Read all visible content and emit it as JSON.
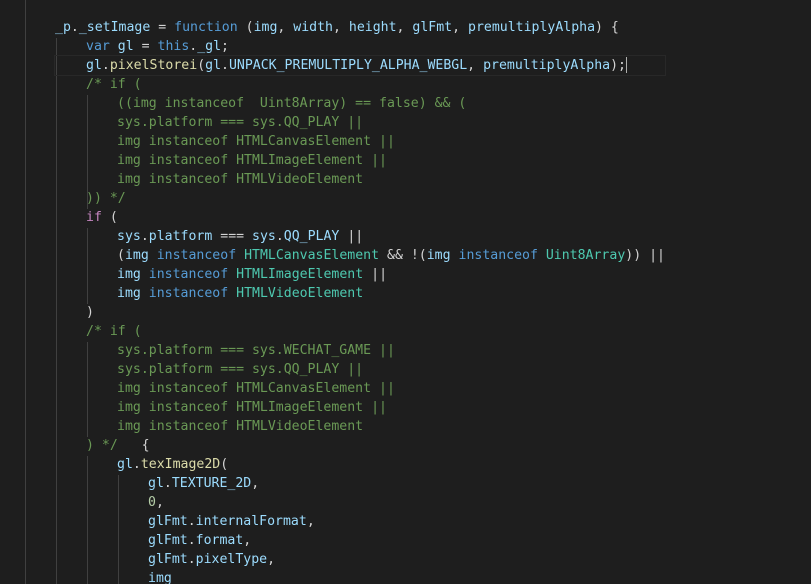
{
  "editor": {
    "theme": {
      "background": "#1e1e1e",
      "default": "#d4d4d4",
      "keyword": "#569cd6",
      "control": "#c586c0",
      "function": "#dcdcaa",
      "variable": "#9cdcfe",
      "type": "#4ec9b0",
      "number": "#b5cea8",
      "comment": "#6a9955",
      "guide": "#404040"
    },
    "cursor_line": 3,
    "lines": [
      {
        "indent": 0,
        "tokens": [
          [
            "_p",
            "variable"
          ],
          [
            ".",
            ""
          ],
          [
            "_setImage",
            "variable"
          ],
          [
            " = ",
            ""
          ],
          [
            "function",
            "keyword"
          ],
          [
            " (",
            ""
          ],
          [
            "img",
            "variable"
          ],
          [
            ", ",
            ""
          ],
          [
            "width",
            "variable"
          ],
          [
            ", ",
            ""
          ],
          [
            "height",
            "variable"
          ],
          [
            ", ",
            ""
          ],
          [
            "glFmt",
            "variable"
          ],
          [
            ", ",
            ""
          ],
          [
            "premultiplyAlpha",
            "variable"
          ],
          [
            ") {",
            ""
          ]
        ]
      },
      {
        "indent": 1,
        "tokens": [
          [
            "var",
            "keyword"
          ],
          [
            " ",
            ""
          ],
          [
            "gl",
            "variable"
          ],
          [
            " = ",
            ""
          ],
          [
            "this",
            "keyword"
          ],
          [
            ".",
            ""
          ],
          [
            "_gl",
            "variable"
          ],
          [
            ";",
            ""
          ]
        ]
      },
      {
        "indent": 1,
        "tokens": [
          [
            "gl",
            "variable"
          ],
          [
            ".",
            ""
          ],
          [
            "pixelStorei",
            "function"
          ],
          [
            "(",
            ""
          ],
          [
            "gl",
            "variable"
          ],
          [
            ".",
            ""
          ],
          [
            "UNPACK_PREMULTIPLY_ALPHA_WEBGL",
            "variable"
          ],
          [
            ", ",
            ""
          ],
          [
            "premultiplyAlpha",
            "variable"
          ],
          [
            ");",
            ""
          ]
        ]
      },
      {
        "indent": 1,
        "tokens": [
          [
            "/* if (",
            "comment"
          ]
        ]
      },
      {
        "indent": 2,
        "tokens": [
          [
            "((img instanceof  Uint8Array) == false) && (",
            "comment"
          ]
        ]
      },
      {
        "indent": 2,
        "tokens": [
          [
            "sys.platform === sys.QQ_PLAY ||",
            "comment"
          ]
        ]
      },
      {
        "indent": 2,
        "tokens": [
          [
            "img instanceof HTMLCanvasElement ||",
            "comment"
          ]
        ]
      },
      {
        "indent": 2,
        "tokens": [
          [
            "img instanceof HTMLImageElement ||",
            "comment"
          ]
        ]
      },
      {
        "indent": 2,
        "tokens": [
          [
            "img instanceof HTMLVideoElement",
            "comment"
          ]
        ]
      },
      {
        "indent": 1,
        "tokens": [
          [
            ")) */",
            "comment"
          ]
        ]
      },
      {
        "indent": 1,
        "tokens": [
          [
            "if",
            "control"
          ],
          [
            " (",
            ""
          ]
        ]
      },
      {
        "indent": 2,
        "tokens": [
          [
            "sys",
            "variable"
          ],
          [
            ".",
            ""
          ],
          [
            "platform",
            "variable"
          ],
          [
            " === ",
            ""
          ],
          [
            "sys",
            "variable"
          ],
          [
            ".",
            ""
          ],
          [
            "QQ_PLAY",
            "variable"
          ],
          [
            " ||",
            ""
          ]
        ]
      },
      {
        "indent": 2,
        "tokens": [
          [
            "(",
            ""
          ],
          [
            "img",
            "variable"
          ],
          [
            " ",
            ""
          ],
          [
            "instanceof",
            "keyword"
          ],
          [
            " ",
            ""
          ],
          [
            "HTMLCanvasElement",
            "type"
          ],
          [
            " && !(",
            ""
          ],
          [
            "img",
            "variable"
          ],
          [
            " ",
            ""
          ],
          [
            "instanceof",
            "keyword"
          ],
          [
            " ",
            ""
          ],
          [
            "Uint8Array",
            "type"
          ],
          [
            ")) ||",
            ""
          ]
        ]
      },
      {
        "indent": 2,
        "tokens": [
          [
            "img",
            "variable"
          ],
          [
            " ",
            ""
          ],
          [
            "instanceof",
            "keyword"
          ],
          [
            " ",
            ""
          ],
          [
            "HTMLImageElement",
            "type"
          ],
          [
            " ||",
            ""
          ]
        ]
      },
      {
        "indent": 2,
        "tokens": [
          [
            "img",
            "variable"
          ],
          [
            " ",
            ""
          ],
          [
            "instanceof",
            "keyword"
          ],
          [
            " ",
            ""
          ],
          [
            "HTMLVideoElement",
            "type"
          ]
        ]
      },
      {
        "indent": 1,
        "tokens": [
          [
            ")",
            ""
          ]
        ]
      },
      {
        "indent": 1,
        "tokens": [
          [
            "/* if (",
            "comment"
          ]
        ]
      },
      {
        "indent": 2,
        "tokens": [
          [
            "sys.platform === sys.WECHAT_GAME ||",
            "comment"
          ]
        ]
      },
      {
        "indent": 2,
        "tokens": [
          [
            "sys.platform === sys.QQ_PLAY ||",
            "comment"
          ]
        ]
      },
      {
        "indent": 2,
        "tokens": [
          [
            "img instanceof HTMLCanvasElement ||",
            "comment"
          ]
        ]
      },
      {
        "indent": 2,
        "tokens": [
          [
            "img instanceof HTMLImageElement ||",
            "comment"
          ]
        ]
      },
      {
        "indent": 2,
        "tokens": [
          [
            "img instanceof HTMLVideoElement",
            "comment"
          ]
        ]
      },
      {
        "indent": 1,
        "tokens": [
          [
            ") */",
            "comment"
          ],
          [
            "   {",
            ""
          ]
        ]
      },
      {
        "indent": 2,
        "tokens": [
          [
            "gl",
            "variable"
          ],
          [
            ".",
            ""
          ],
          [
            "texImage2D",
            "function"
          ],
          [
            "(",
            ""
          ]
        ]
      },
      {
        "indent": 3,
        "tokens": [
          [
            "gl",
            "variable"
          ],
          [
            ".",
            ""
          ],
          [
            "TEXTURE_2D",
            "variable"
          ],
          [
            ",",
            ""
          ]
        ]
      },
      {
        "indent": 3,
        "tokens": [
          [
            "0",
            "number"
          ],
          [
            ",",
            ""
          ]
        ]
      },
      {
        "indent": 3,
        "tokens": [
          [
            "glFmt",
            "variable"
          ],
          [
            ".",
            ""
          ],
          [
            "internalFormat",
            "variable"
          ],
          [
            ",",
            ""
          ]
        ]
      },
      {
        "indent": 3,
        "tokens": [
          [
            "glFmt",
            "variable"
          ],
          [
            ".",
            ""
          ],
          [
            "format",
            "variable"
          ],
          [
            ",",
            ""
          ]
        ]
      },
      {
        "indent": 3,
        "tokens": [
          [
            "glFmt",
            "variable"
          ],
          [
            ".",
            ""
          ],
          [
            "pixelType",
            "variable"
          ],
          [
            ",",
            ""
          ]
        ]
      },
      {
        "indent": 3,
        "tokens": [
          [
            "img",
            "variable"
          ]
        ]
      }
    ]
  }
}
